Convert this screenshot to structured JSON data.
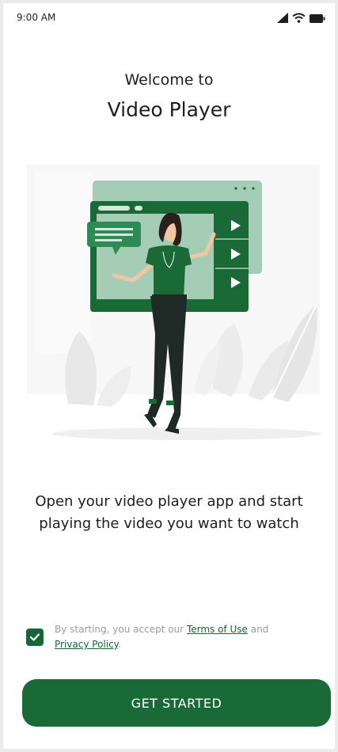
{
  "status_bar": {
    "time": "9:00 AM",
    "icons": [
      "signal-icon",
      "wifi-icon",
      "battery-icon"
    ]
  },
  "header": {
    "welcome": "Welcome to",
    "app_name": "Video Player"
  },
  "illustration": {
    "name": "woman-with-video-player-illustration"
  },
  "description": "Open your video player app and start playing the video you want to watch",
  "consent": {
    "checked": true,
    "prefix": "By starting, you accept our",
    "terms_link": "Terms of Use",
    "middle": "and",
    "privacy_link": "Privacy Policy",
    "suffix": "."
  },
  "cta": {
    "label": "GET STARTED"
  },
  "colors": {
    "primary": "#196a36",
    "primary_light": "#2e8b57",
    "pale_green": "#a5ccb4",
    "background": "#ffffff",
    "text_dark": "#1e1e1e",
    "text_muted": "#9a9a9a"
  }
}
